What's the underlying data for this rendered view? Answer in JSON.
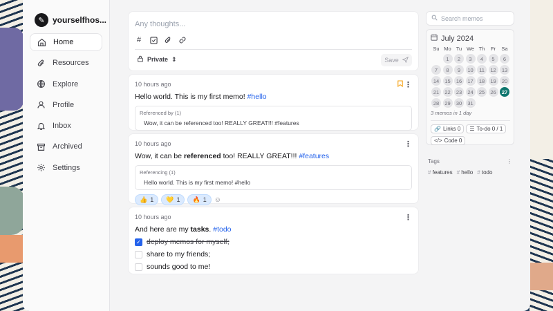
{
  "user": {
    "name": "yourselfhos..."
  },
  "nav": [
    {
      "label": "Home",
      "icon": "home-icon",
      "active": true
    },
    {
      "label": "Resources",
      "icon": "paperclip-icon"
    },
    {
      "label": "Explore",
      "icon": "globe-icon"
    },
    {
      "label": "Profile",
      "icon": "user-icon"
    },
    {
      "label": "Inbox",
      "icon": "bell-icon"
    },
    {
      "label": "Archived",
      "icon": "archive-icon"
    },
    {
      "label": "Settings",
      "icon": "gear-icon"
    }
  ],
  "editor": {
    "placeholder": "Any thoughts...",
    "visibility": "Private",
    "save_label": "Save"
  },
  "memos": [
    {
      "time": "10 hours ago",
      "text": "Hello world. This is my first memo! ",
      "tag": "#hello",
      "ref_title": "Referenced by (1)",
      "ref_item": "Wow, it can be referenced too! REALLY GREAT!!! #features"
    },
    {
      "time": "10 hours ago",
      "text_a": "Wow, it can be ",
      "text_bold": "referenced",
      "text_b": " too! REALLY GREAT!!! ",
      "tag": "#features",
      "ref_title": "Referencing (1)",
      "ref_item": "Hello world. This is my first memo! #hello",
      "reactions": [
        {
          "emoji": "👍",
          "count": "1"
        },
        {
          "emoji": "💛",
          "count": "1"
        },
        {
          "emoji": "🔥",
          "count": "1"
        }
      ]
    },
    {
      "time": "10 hours ago",
      "text_a": "And here are my ",
      "text_bold": "tasks",
      "text_b": ". ",
      "tag": "#todo",
      "tasks": [
        {
          "label": "deploy memos for myself;",
          "done": true
        },
        {
          "label": "share to my friends;",
          "done": false
        },
        {
          "label": "sounds good to me!",
          "done": false
        }
      ]
    }
  ],
  "search": {
    "placeholder": "Search memos"
  },
  "calendar": {
    "month": "July 2024",
    "weekdays": [
      "Su",
      "Mo",
      "Tu",
      "We",
      "Th",
      "Fr",
      "Sa"
    ],
    "days": [
      "",
      "1",
      "2",
      "3",
      "4",
      "5",
      "6",
      "7",
      "8",
      "9",
      "10",
      "11",
      "12",
      "13",
      "14",
      "15",
      "16",
      "17",
      "18",
      "19",
      "20",
      "21",
      "22",
      "23",
      "24",
      "25",
      "26",
      "27",
      "28",
      "29",
      "30",
      "31"
    ],
    "today": "27",
    "note": "3 memos in 1 day"
  },
  "stats": {
    "links": "Links 0",
    "todo": "To-do 0 / 1",
    "code": "Code 0"
  },
  "tags": {
    "heading": "Tags",
    "items": [
      "features",
      "hello",
      "todo"
    ]
  },
  "colors": {
    "accent": "#2563eb",
    "today": "#0f766e",
    "bookmark": "#f59e0b"
  }
}
